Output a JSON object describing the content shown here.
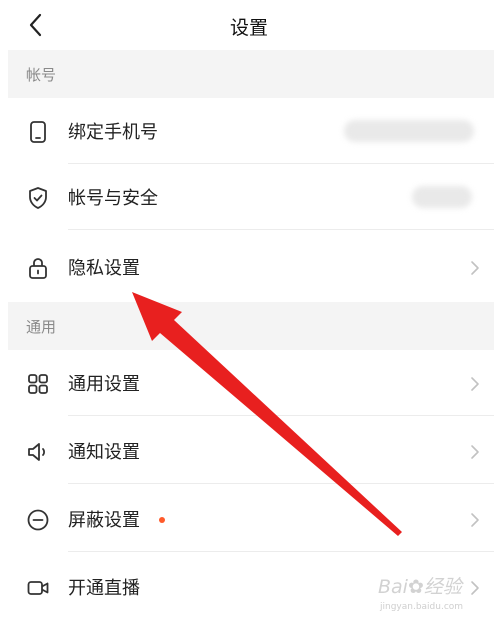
{
  "header": {
    "title": "设置"
  },
  "sections": [
    {
      "title": "帐号"
    },
    {
      "title": "通用"
    }
  ],
  "rows": [
    {
      "label": "绑定手机号",
      "icon": "phone-icon"
    },
    {
      "label": "帐号与安全",
      "icon": "shield-check-icon"
    },
    {
      "label": "隐私设置",
      "icon": "lock-icon"
    },
    {
      "label": "通用设置",
      "icon": "grid-icon"
    },
    {
      "label": "通知设置",
      "icon": "speaker-icon"
    },
    {
      "label": "屏蔽设置",
      "icon": "block-icon"
    },
    {
      "label": "开通直播",
      "icon": "video-camera-icon"
    }
  ],
  "colors": {
    "accent_dot": "#ff5a2a",
    "arrow": "#e8201f",
    "section_bg": "#f4f4f4"
  },
  "watermark": {
    "text": "Bai",
    "brand": "经验",
    "url": "jingyan.baidu.com"
  }
}
